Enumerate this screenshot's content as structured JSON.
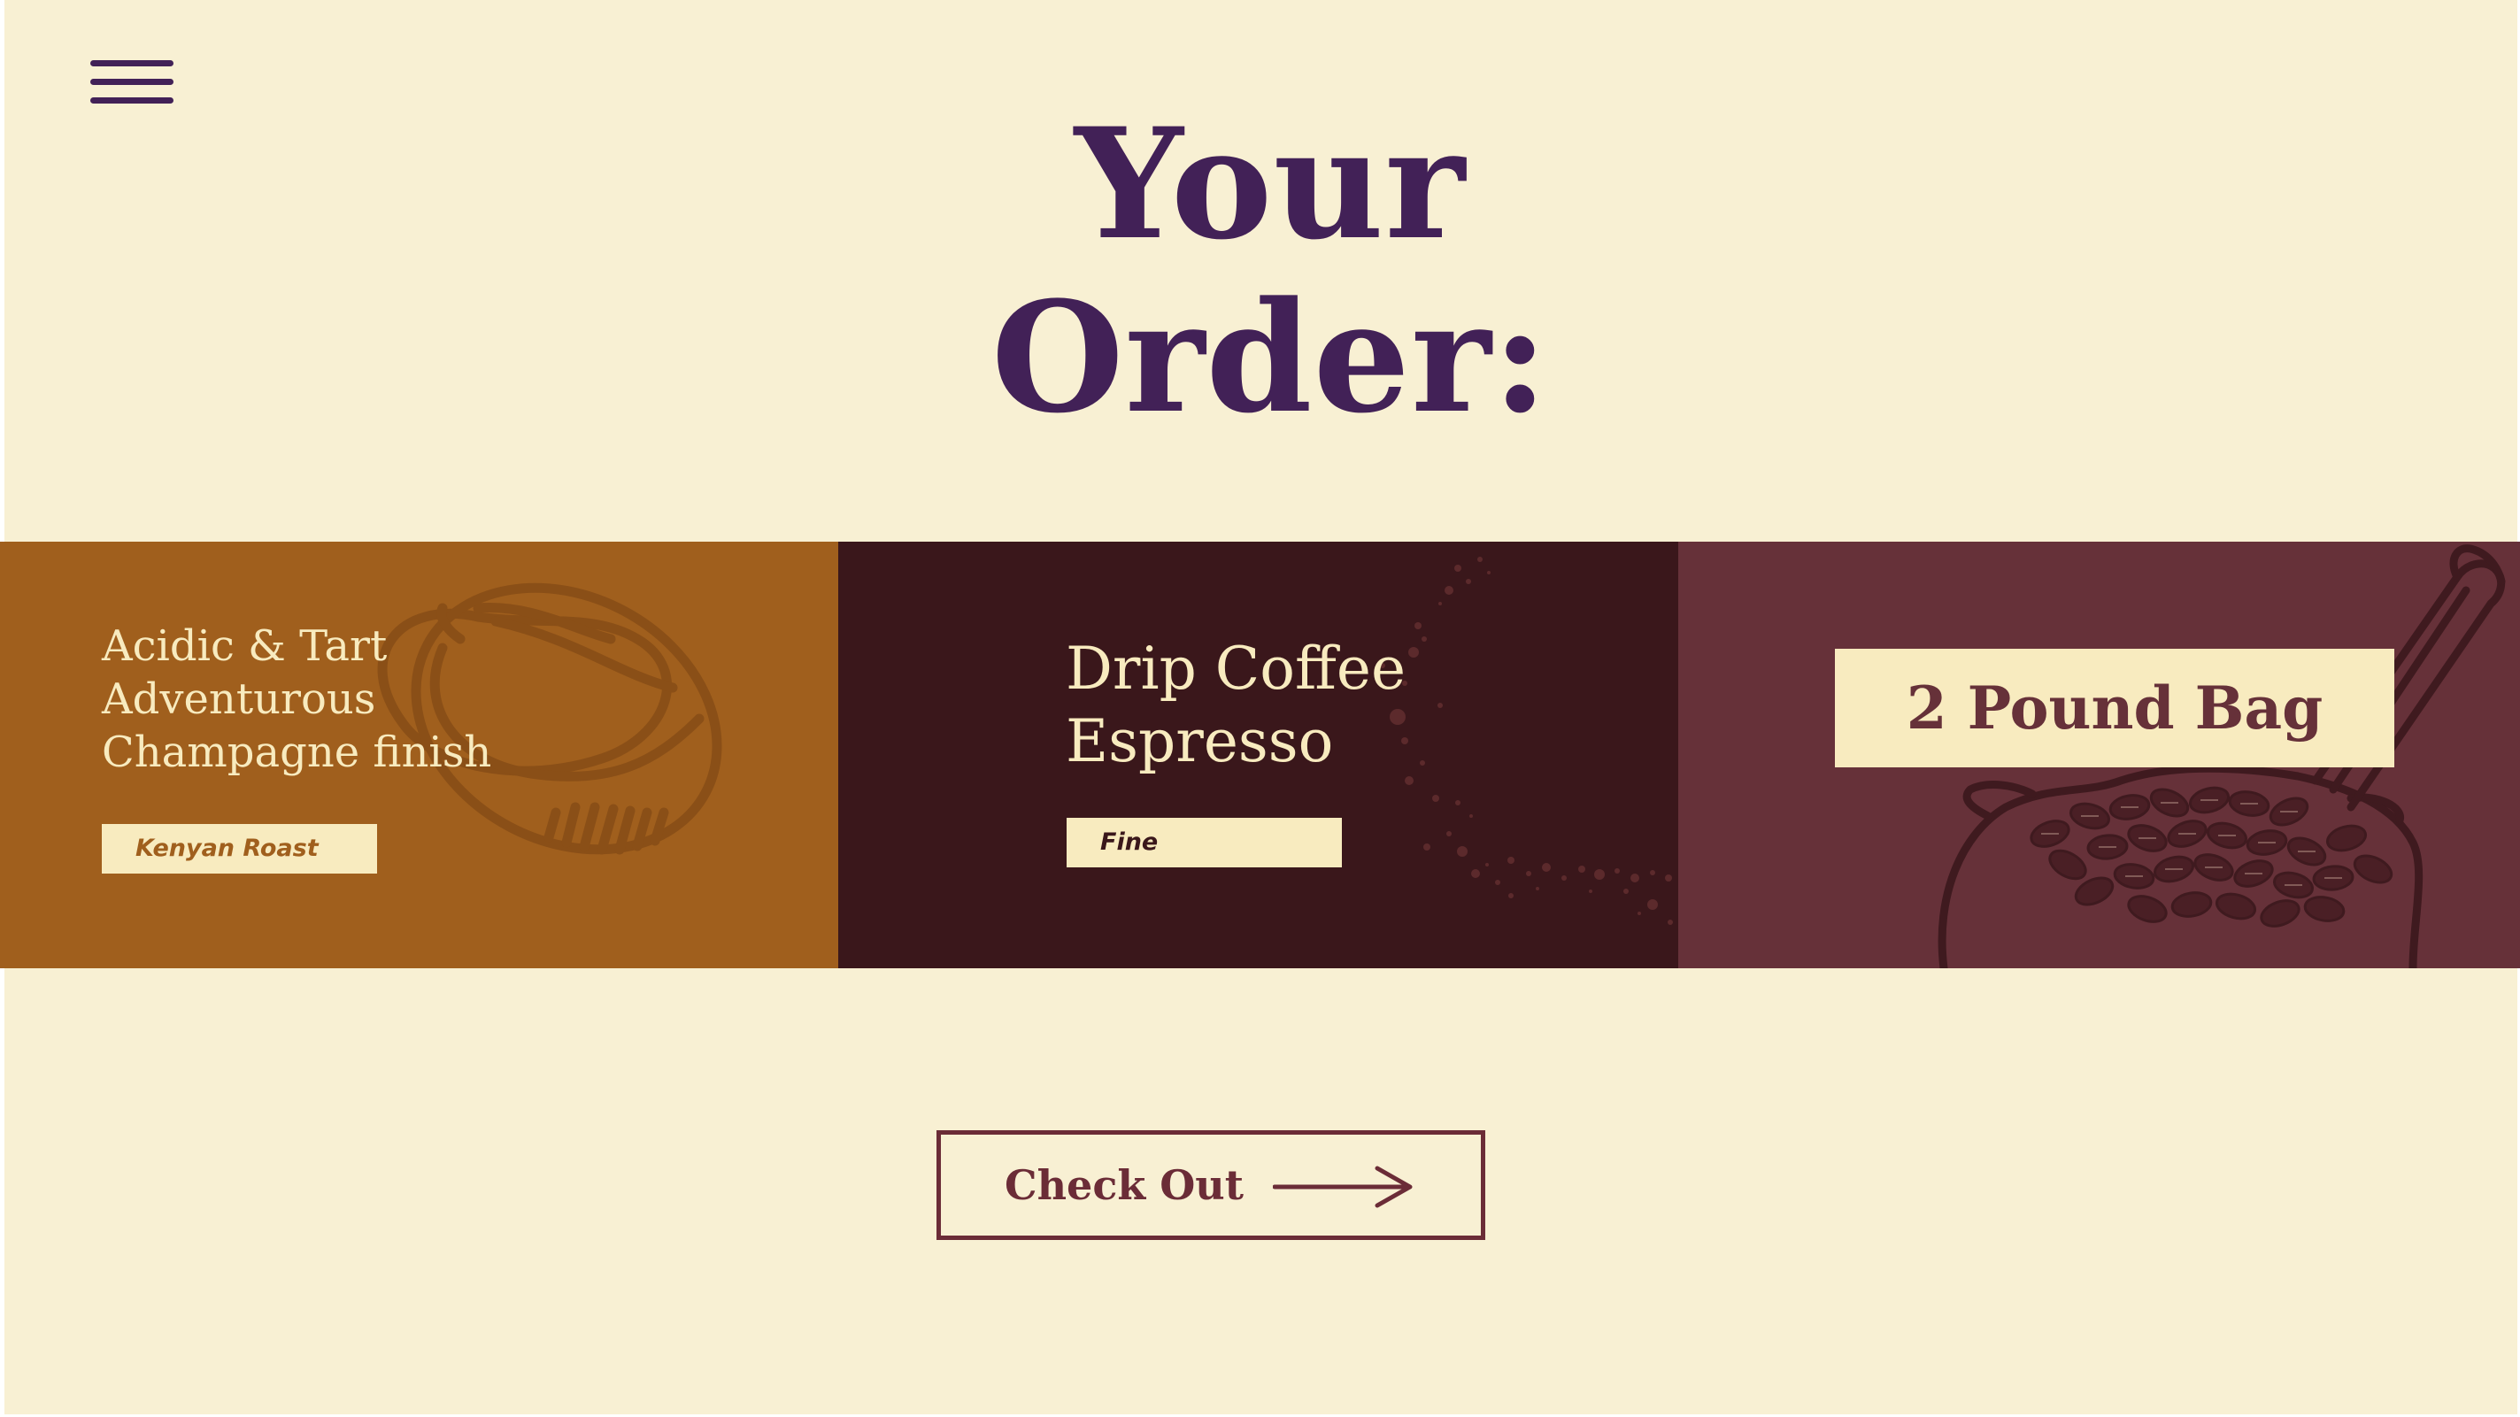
{
  "colors": {
    "background": "#f8f0d3",
    "title": "#422157",
    "menu": "#422157",
    "panel_roast": "#a05f1d",
    "panel_brew": "#3a171b",
    "panel_size": "#663139",
    "cream": "#f8ebbf",
    "roast_tag_text": "#a05f1d",
    "grind_tag_text": "#3a171b",
    "size_text": "#663139",
    "checkout": "#6b2c37"
  },
  "header": {
    "menu_icon": "hamburger-menu-icon"
  },
  "title": {
    "line1": "Your",
    "line2": "Order:"
  },
  "order": {
    "roast": {
      "notes": [
        "Acidic & Tart",
        "Adventurous",
        "Champagne finish"
      ],
      "name": "Kenyan Roast",
      "illustration": "coffee-bean-icon"
    },
    "brew": {
      "methods": [
        "Drip Coffee",
        "Espresso"
      ],
      "grind": "Fine",
      "illustration": "coffee-grounds-splatter"
    },
    "size": {
      "label": "2 Pound Bag",
      "illustration": "coffee-sack-with-scoop"
    }
  },
  "checkout": {
    "label": "Check Out",
    "icon": "arrow-right-icon"
  }
}
